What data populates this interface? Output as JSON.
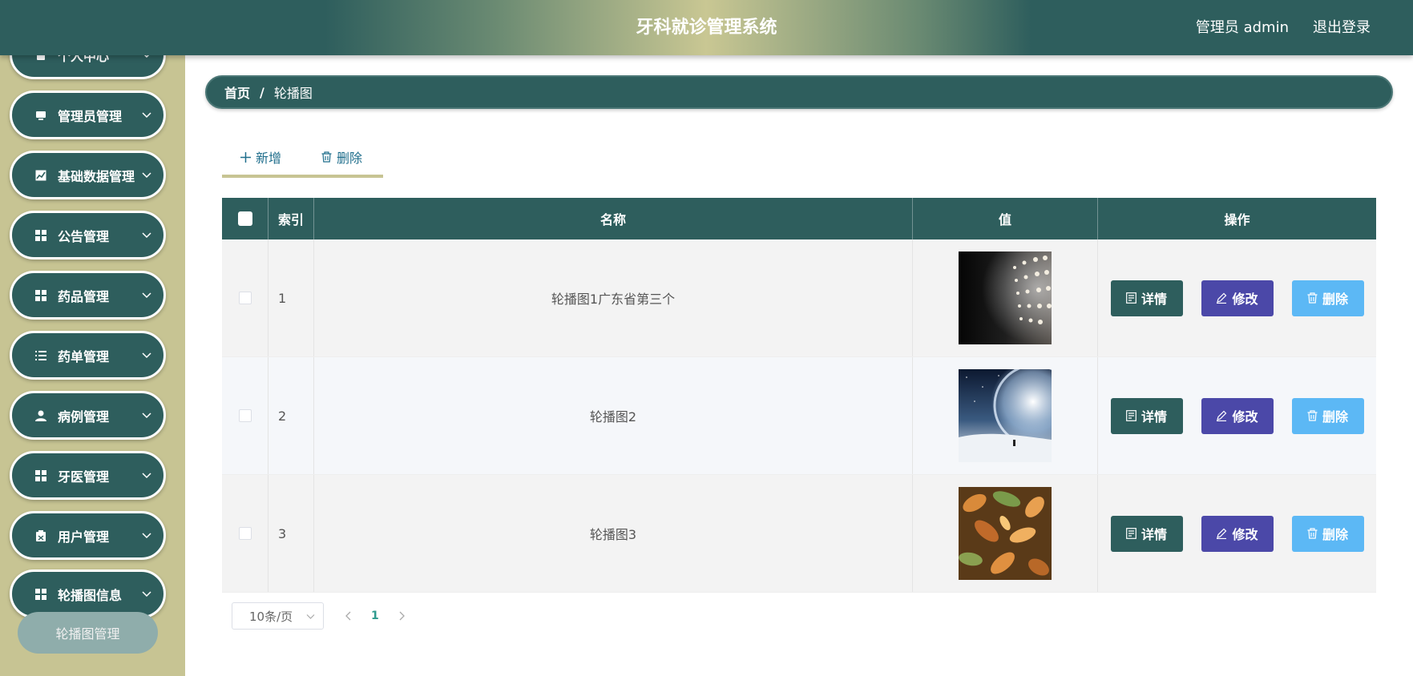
{
  "header": {
    "title": "牙科就诊管理系统",
    "user": "管理员 admin",
    "logout": "退出登录"
  },
  "sidebar": {
    "items": [
      {
        "label": "个人中心",
        "icon": "person-icon"
      },
      {
        "label": "管理员管理",
        "icon": "monitor-icon"
      },
      {
        "label": "基础数据管理",
        "icon": "chart-icon"
      },
      {
        "label": "公告管理",
        "icon": "grid-icon"
      },
      {
        "label": "药品管理",
        "icon": "grid-icon"
      },
      {
        "label": "药单管理",
        "icon": "list-icon"
      },
      {
        "label": "病例管理",
        "icon": "user-icon"
      },
      {
        "label": "牙医管理",
        "icon": "grid-icon"
      },
      {
        "label": "用户管理",
        "icon": "clipboard-icon"
      },
      {
        "label": "轮播图信息",
        "icon": "grid-icon"
      }
    ],
    "active_sub": "轮播图管理"
  },
  "breadcrumb": {
    "home": "首页",
    "separator": "/",
    "current": "轮播图"
  },
  "actions": {
    "add": "新增",
    "delete": "删除"
  },
  "table": {
    "headers": {
      "index": "索引",
      "name": "名称",
      "value": "值",
      "ops": "操作"
    },
    "rows": [
      {
        "index": "1",
        "name": "轮播图1广东省第三个",
        "image": "dark-lights"
      },
      {
        "index": "2",
        "name": "轮播图2",
        "image": "space-planet"
      },
      {
        "index": "3",
        "name": "轮播图3",
        "image": "autumn-leaves"
      }
    ],
    "buttons": {
      "detail": "详情",
      "edit": "修改",
      "delete": "删除"
    }
  },
  "pagination": {
    "page_size": "10条/页",
    "current_page": "1"
  },
  "colors": {
    "primary": "#2e5e5d",
    "sidebar": "#c7c493",
    "edit": "#4b48a8",
    "delete": "#5cb8f5"
  }
}
